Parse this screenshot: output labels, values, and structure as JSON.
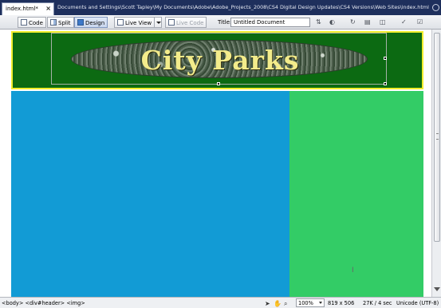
{
  "tabbar": {
    "tab_label": "index.html*",
    "tab_close": "×",
    "path": "Documents and Settings\\Scott Tapley\\My Documents\\Adobe\\Adobe_Projects_2008\\CS4 Digital Design Updates\\CS4 Versions\\Web Sites\\index.html"
  },
  "toolbar": {
    "code_label": "Code",
    "split_label": "Split",
    "design_label": "Design",
    "live_view_label": "Live View",
    "live_code_label": "Live Code",
    "title_label": "Title:",
    "title_value": "Untitled Document"
  },
  "header": {
    "logo_text": "City Parks"
  },
  "colors": {
    "header_bg": "#0c6a12",
    "header_border": "#f2ee2c",
    "left_column": "#129bd5",
    "right_column": "#33cc66"
  },
  "statusbar": {
    "tags": [
      "<body>",
      "<div#header>",
      "<img>"
    ],
    "zoom": "100%",
    "window_size": "819 x 506",
    "download": "27K / 4 sec",
    "encoding": "Unicode (UTF-8)"
  }
}
